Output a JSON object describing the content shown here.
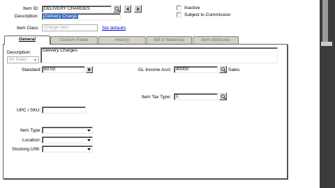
{
  "header": {
    "item_id_label": "Item ID:",
    "item_id_value": "DELIVERY CHARGES",
    "description_label": "Description:",
    "description_value": "Delivery Charge",
    "item_class_label": "Item Class",
    "item_class_value": "Charge item",
    "set_defaults_link": "Set defaults",
    "inactive_label": "Inactive",
    "subject_commission_label": "Subject to Commission"
  },
  "tabs": [
    {
      "label": "General"
    },
    {
      "label": "Custom Fields"
    },
    {
      "label": "History"
    },
    {
      "label": "Bill of Materials"
    },
    {
      "label": "Item Attributes"
    }
  ],
  "general": {
    "description_label": "Description:",
    "description_value": "Delivery Charges",
    "for_sales_value": "for Sales",
    "standard_label": "Standard:",
    "standard_value": "60.00",
    "gl_income_label": "GL Income Acct:",
    "gl_income_value": "40000",
    "gl_income_desc": "Sales",
    "item_tax_type_label": "Item Tax Type:",
    "item_tax_type_value": "1",
    "upc_label": "UPC / SKU:",
    "upc_value": "",
    "item_type_label": "Item Type:",
    "item_type_value": "",
    "location_label": "Location:",
    "location_value": "",
    "stocking_um_label": "Stocking U/M:",
    "stocking_um_value": ""
  },
  "colors": {
    "window_bg": "#ffffff",
    "panel_border": "#606060",
    "selection": "#316ac5",
    "link": "#0000cc"
  },
  "icons": [
    "magnifier-icon",
    "left-arrow-icon",
    "right-arrow-icon",
    "right-arrow-icon",
    "chevron-down-icon"
  ]
}
